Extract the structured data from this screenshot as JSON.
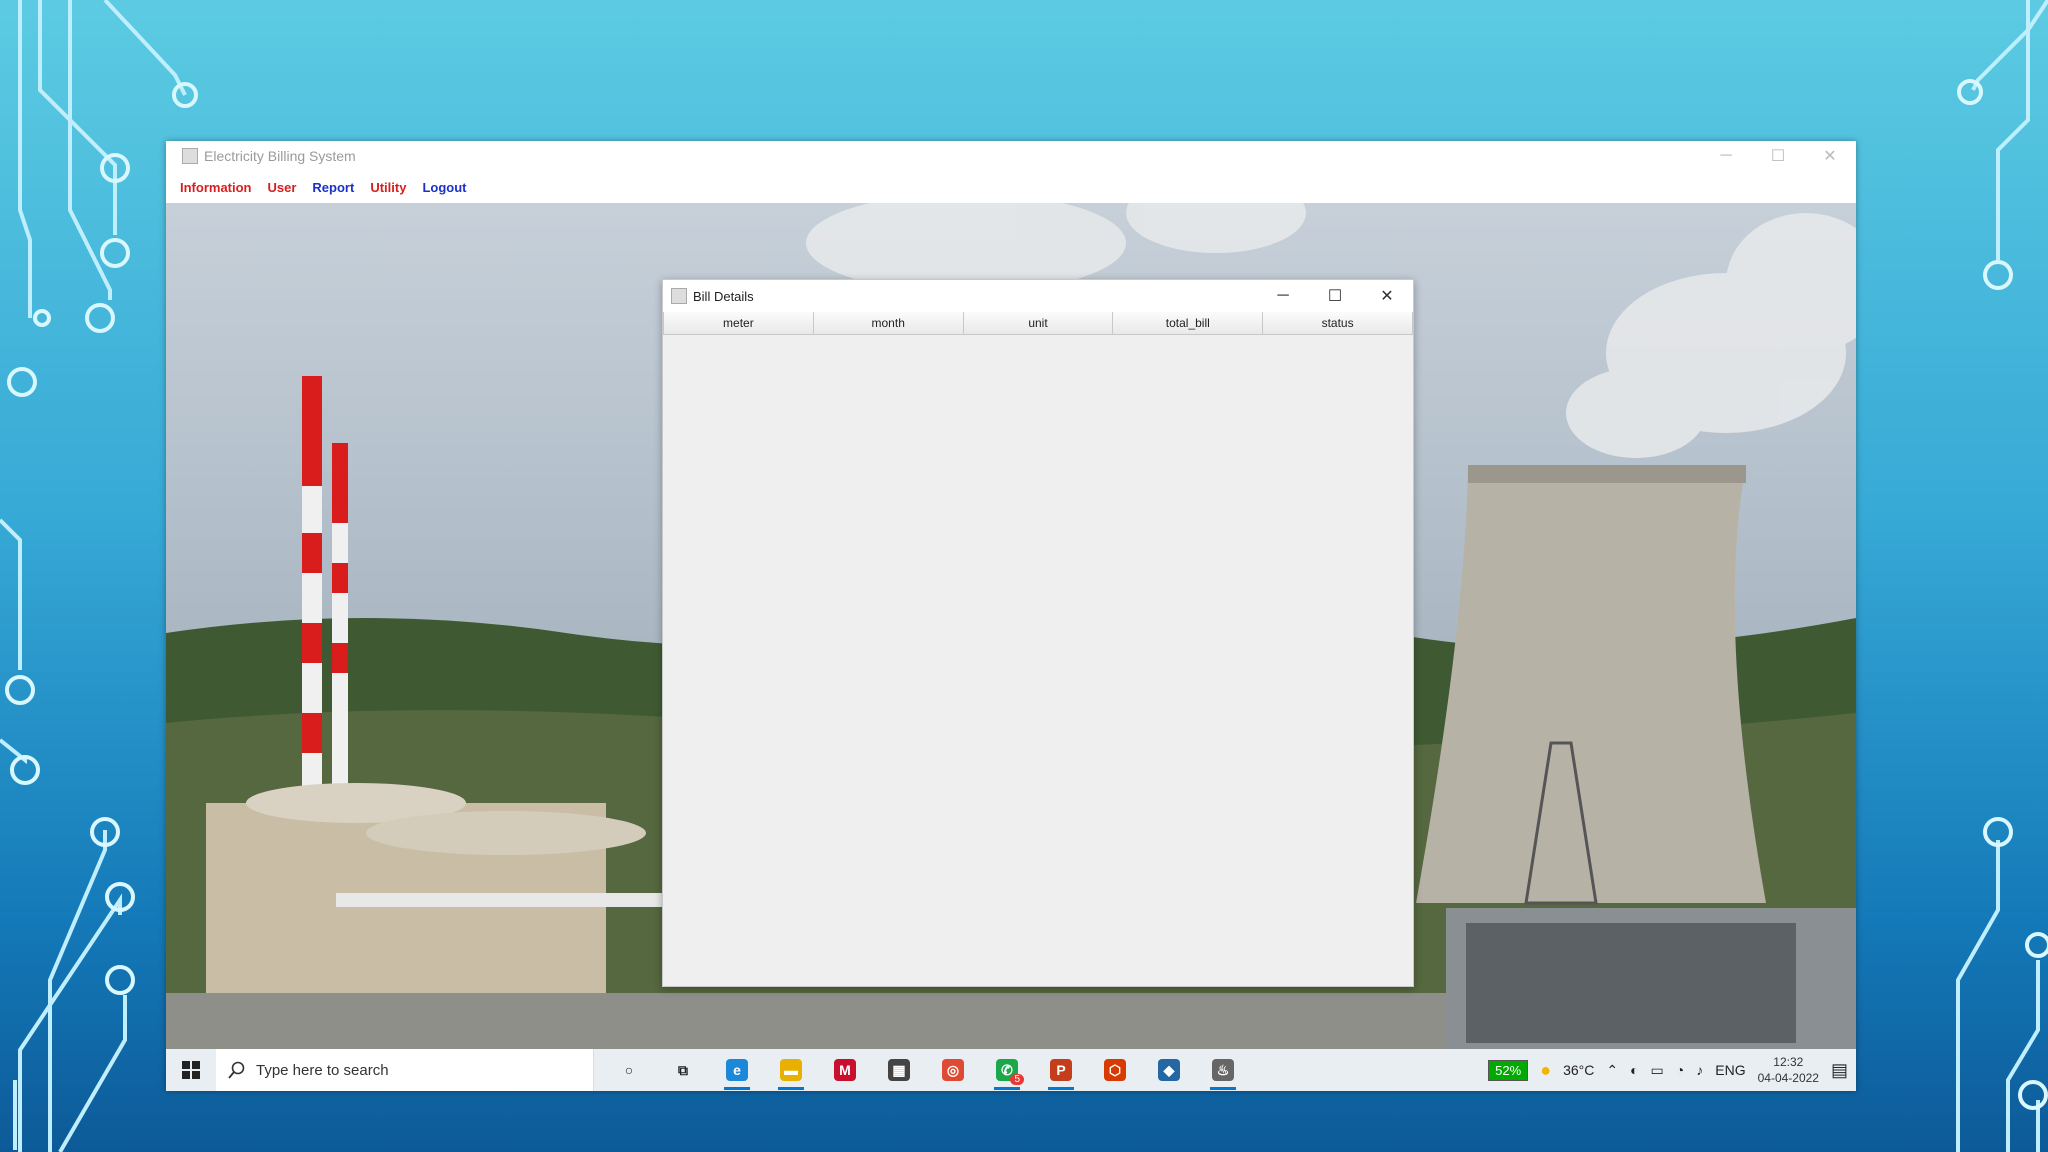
{
  "app_window": {
    "title": "Electricity Billing System",
    "controls": [
      "─",
      "☐",
      "✕"
    ],
    "menu": [
      {
        "label": "Information",
        "color": "#d81e1e"
      },
      {
        "label": "User",
        "color": "#d81e1e"
      },
      {
        "label": "Report",
        "color": "#1a32c8"
      },
      {
        "label": "Utility",
        "color": "#d81e1e"
      },
      {
        "label": "Logout",
        "color": "#1a32c8"
      }
    ]
  },
  "dialog": {
    "title": "Bill Details",
    "controls": [
      "─",
      "☐",
      "✕"
    ],
    "columns": [
      "meter",
      "month",
      "unit",
      "total_bill",
      "status"
    ],
    "rows": []
  },
  "taskbar": {
    "search_placeholder": "Type here to search",
    "pinned": [
      {
        "name": "cortana-icon",
        "glyph": "○",
        "color": "#222"
      },
      {
        "name": "task-view-icon",
        "glyph": "⧉",
        "color": "#222"
      },
      {
        "name": "edge-icon",
        "glyph": "e",
        "color": "#1e88d8"
      },
      {
        "name": "file-explorer-icon",
        "glyph": "▬",
        "color": "#e8b000"
      },
      {
        "name": "mcafee-icon",
        "glyph": "M",
        "color": "#c8102e"
      },
      {
        "name": "calculator-icon",
        "glyph": "▦",
        "color": "#444"
      },
      {
        "name": "chrome-icon",
        "glyph": "◎",
        "color": "#de4a33"
      },
      {
        "name": "whatsapp-icon",
        "glyph": "✆",
        "color": "#1aa84a"
      },
      {
        "name": "powerpoint-icon",
        "glyph": "P",
        "color": "#c43e1c"
      },
      {
        "name": "office-icon",
        "glyph": "⬡",
        "color": "#d83b01"
      },
      {
        "name": "netbeans-icon",
        "glyph": "◆",
        "color": "#2467a3"
      },
      {
        "name": "java-icon",
        "glyph": "♨",
        "color": "#666"
      }
    ],
    "whatsapp_badge": "5",
    "battery": "52%",
    "temperature": "36°C",
    "language": "ENG",
    "time": "12:32",
    "date": "04-04-2022"
  }
}
